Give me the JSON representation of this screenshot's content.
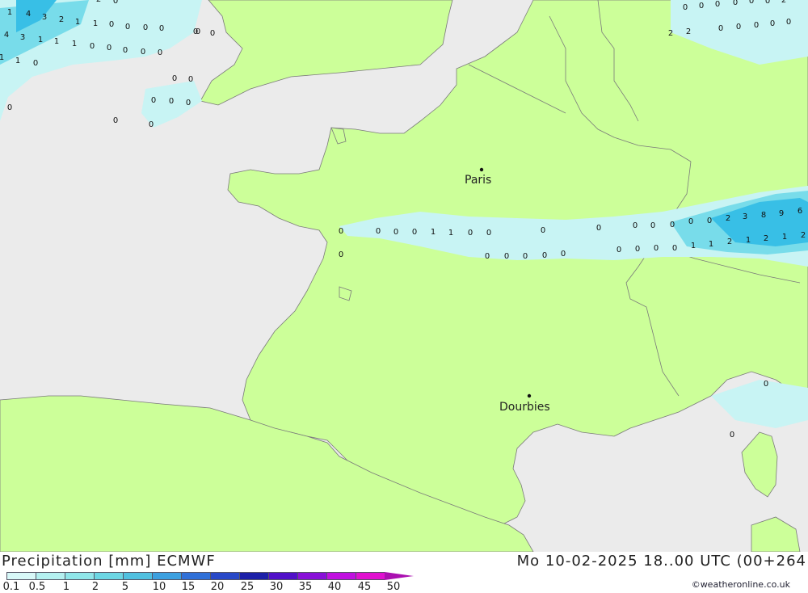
{
  "map": {
    "cities": [
      {
        "name": "Paris"
      },
      {
        "name": "Dourbies"
      }
    ],
    "precip_values": [
      "1",
      "4",
      "3",
      "2",
      "1",
      "1",
      "0",
      "0",
      "0",
      "0",
      "0",
      "4",
      "3",
      "1",
      "1",
      "1",
      "0",
      "0",
      "0",
      "0",
      "0",
      "1",
      "1",
      "0",
      "0",
      "0",
      "0",
      "0",
      "0",
      "0",
      "0",
      "0",
      "0",
      "0",
      "0",
      "0",
      "0",
      "0",
      "0",
      "0",
      "1",
      "1",
      "0",
      "0",
      "0",
      "0",
      "0",
      "0",
      "0",
      "0",
      "0",
      "0",
      "0",
      "0",
      "0",
      "0",
      "0",
      "0",
      "2",
      "3",
      "8",
      "9",
      "6",
      "1",
      "1",
      "2",
      "1",
      "2",
      "1",
      "2",
      "0",
      "0",
      "0",
      "0",
      "0",
      "0",
      "0",
      "2",
      "2",
      "2",
      "0",
      "0",
      "0",
      "0",
      "0",
      "0",
      "0",
      "2",
      "0",
      "0"
    ]
  },
  "footer": {
    "title_left": "Precipitation [mm] ECMWF",
    "title_right": "Mo 10-02-2025 18..00 UTC (00+264",
    "credit": "©weatheronline.co.uk"
  },
  "legend": {
    "labels": [
      "0.1",
      "0.5",
      "1",
      "2",
      "5",
      "10",
      "15",
      "20",
      "25",
      "30",
      "35",
      "40",
      "45",
      "50"
    ],
    "colors": [
      "#d8f8f8",
      "#b4f0f0",
      "#90e6ea",
      "#6cd6e4",
      "#50c0e0",
      "#3ca0e0",
      "#3070d8",
      "#2848c8",
      "#1c20a8",
      "#5010c8",
      "#8810d8",
      "#c010e0",
      "#e010d0",
      "#aa10b0"
    ]
  },
  "colors": {
    "land": "#ccff99",
    "sea": "#ebebeb",
    "border": "#7a7a7a",
    "precip_light": "#c8f4f4",
    "precip_mid": "#78dcea",
    "precip_heavy": "#38bfe6"
  }
}
